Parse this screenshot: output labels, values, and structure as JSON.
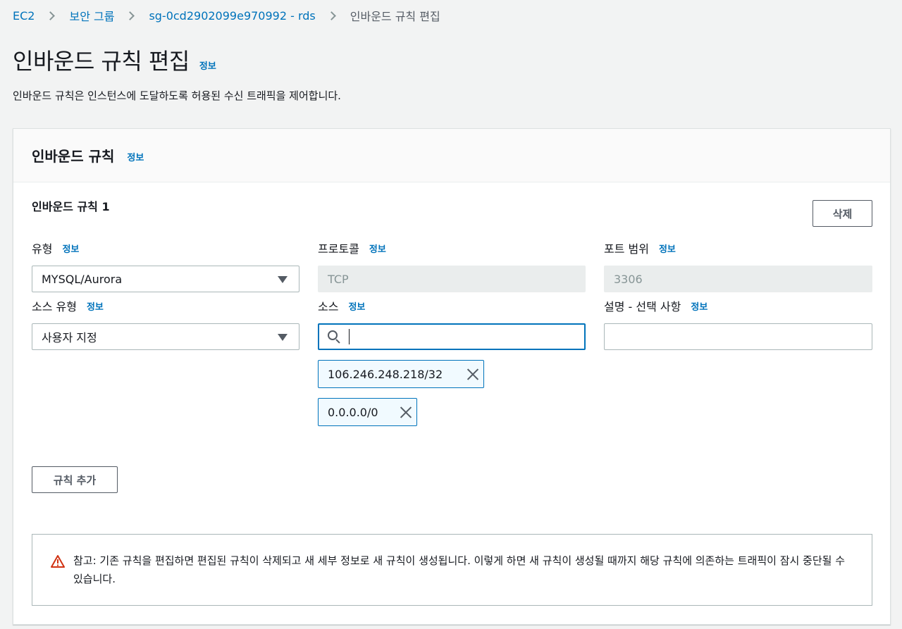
{
  "breadcrumb": {
    "items": [
      "EC2",
      "보안 그룹",
      "sg-0cd2902099e970992 - rds"
    ],
    "current": "인바운드 규칙 편집"
  },
  "page": {
    "title": "인바운드 규칙 편집",
    "info": "정보",
    "description": "인바운드 규칙은 인스턴스에 도달하도록 허용된 수신 트래픽을 제어합니다."
  },
  "panel": {
    "title": "인바운드 규칙",
    "info": "정보"
  },
  "rule": {
    "title": "인바운드 규칙 1",
    "delete_label": "삭제",
    "type": {
      "label": "유형",
      "info": "정보",
      "value": "MYSQL/Aurora"
    },
    "protocol": {
      "label": "프로토콜",
      "info": "정보",
      "value": "TCP"
    },
    "port_range": {
      "label": "포트 범위",
      "info": "정보",
      "value": "3306"
    },
    "source_type": {
      "label": "소스 유형",
      "info": "정보",
      "value": "사용자 지정"
    },
    "source": {
      "label": "소스",
      "info": "정보",
      "value": "",
      "tokens": [
        "106.246.248.218/32",
        "0.0.0.0/0"
      ]
    },
    "description": {
      "label": "설명 - 선택 사항",
      "info": "정보",
      "value": ""
    }
  },
  "add_rule_label": "규칙 추가",
  "alert": {
    "text": "참고: 기존 규칙을 편집하면 편집된 규칙이 삭제되고 새 세부 정보로 새 규칙이 생성됩니다. 이렇게 하면 새 규칙이 생성될 때까지 해당 규칙에 의존하는 트래픽이 잠시 중단될 수 있습니다.",
    "icon": "warning-icon",
    "icon_color": "#d13212"
  },
  "colors": {
    "link": "#0073bb",
    "background": "#f2f3f3",
    "focus_border": "#0073bb",
    "token_background": "#f1faff"
  }
}
